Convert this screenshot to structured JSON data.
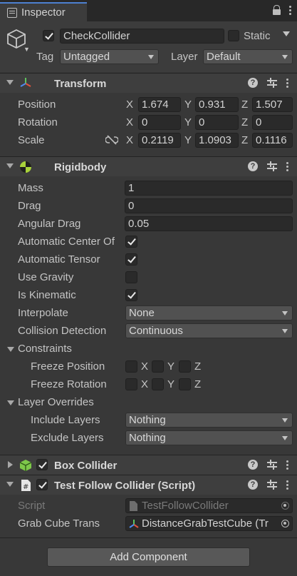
{
  "tab": {
    "title": "Inspector"
  },
  "header": {
    "name": "CheckCollider",
    "static_label": "Static",
    "tag_label": "Tag",
    "tag_value": "Untagged",
    "layer_label": "Layer",
    "layer_value": "Default"
  },
  "transform": {
    "title": "Transform",
    "position": {
      "label": "Position",
      "x": "1.674",
      "y": "0.931",
      "z": "1.507"
    },
    "rotation": {
      "label": "Rotation",
      "x": "0",
      "y": "0",
      "z": "0"
    },
    "scale": {
      "label": "Scale",
      "x": "0.2119",
      "y": "1.0903",
      "z": "0.1116"
    },
    "axes": {
      "x": "X",
      "y": "Y",
      "z": "Z"
    }
  },
  "rigidbody": {
    "title": "Rigidbody",
    "mass": {
      "label": "Mass",
      "value": "1"
    },
    "drag": {
      "label": "Drag",
      "value": "0"
    },
    "angular_drag": {
      "label": "Angular Drag",
      "value": "0.05"
    },
    "auto_com": {
      "label": "Automatic Center Of",
      "checked": true
    },
    "auto_tensor": {
      "label": "Automatic Tensor",
      "checked": true
    },
    "use_gravity": {
      "label": "Use Gravity",
      "checked": false
    },
    "is_kinematic": {
      "label": "Is Kinematic",
      "checked": true
    },
    "interpolate": {
      "label": "Interpolate",
      "value": "None"
    },
    "collision": {
      "label": "Collision Detection",
      "value": "Continuous"
    },
    "constraints": {
      "label": "Constraints",
      "freeze_position": "Freeze Position",
      "freeze_rotation": "Freeze Rotation"
    },
    "layer_overrides": {
      "label": "Layer Overrides",
      "include_label": "Include Layers",
      "include_value": "Nothing",
      "exclude_label": "Exclude Layers",
      "exclude_value": "Nothing"
    }
  },
  "box_collider": {
    "title": "Box Collider"
  },
  "test_follow": {
    "title": "Test Follow Collider (Script)",
    "script_label": "Script",
    "script_value": "TestFollowCollider",
    "grab_label": "Grab Cube Trans",
    "grab_value": "DistanceGrabTestCube (Tr"
  },
  "add_component": "Add Component",
  "colors": {
    "accent_tab": "#4d80d0",
    "panel": "#383838",
    "field": "#2a2a2a"
  }
}
